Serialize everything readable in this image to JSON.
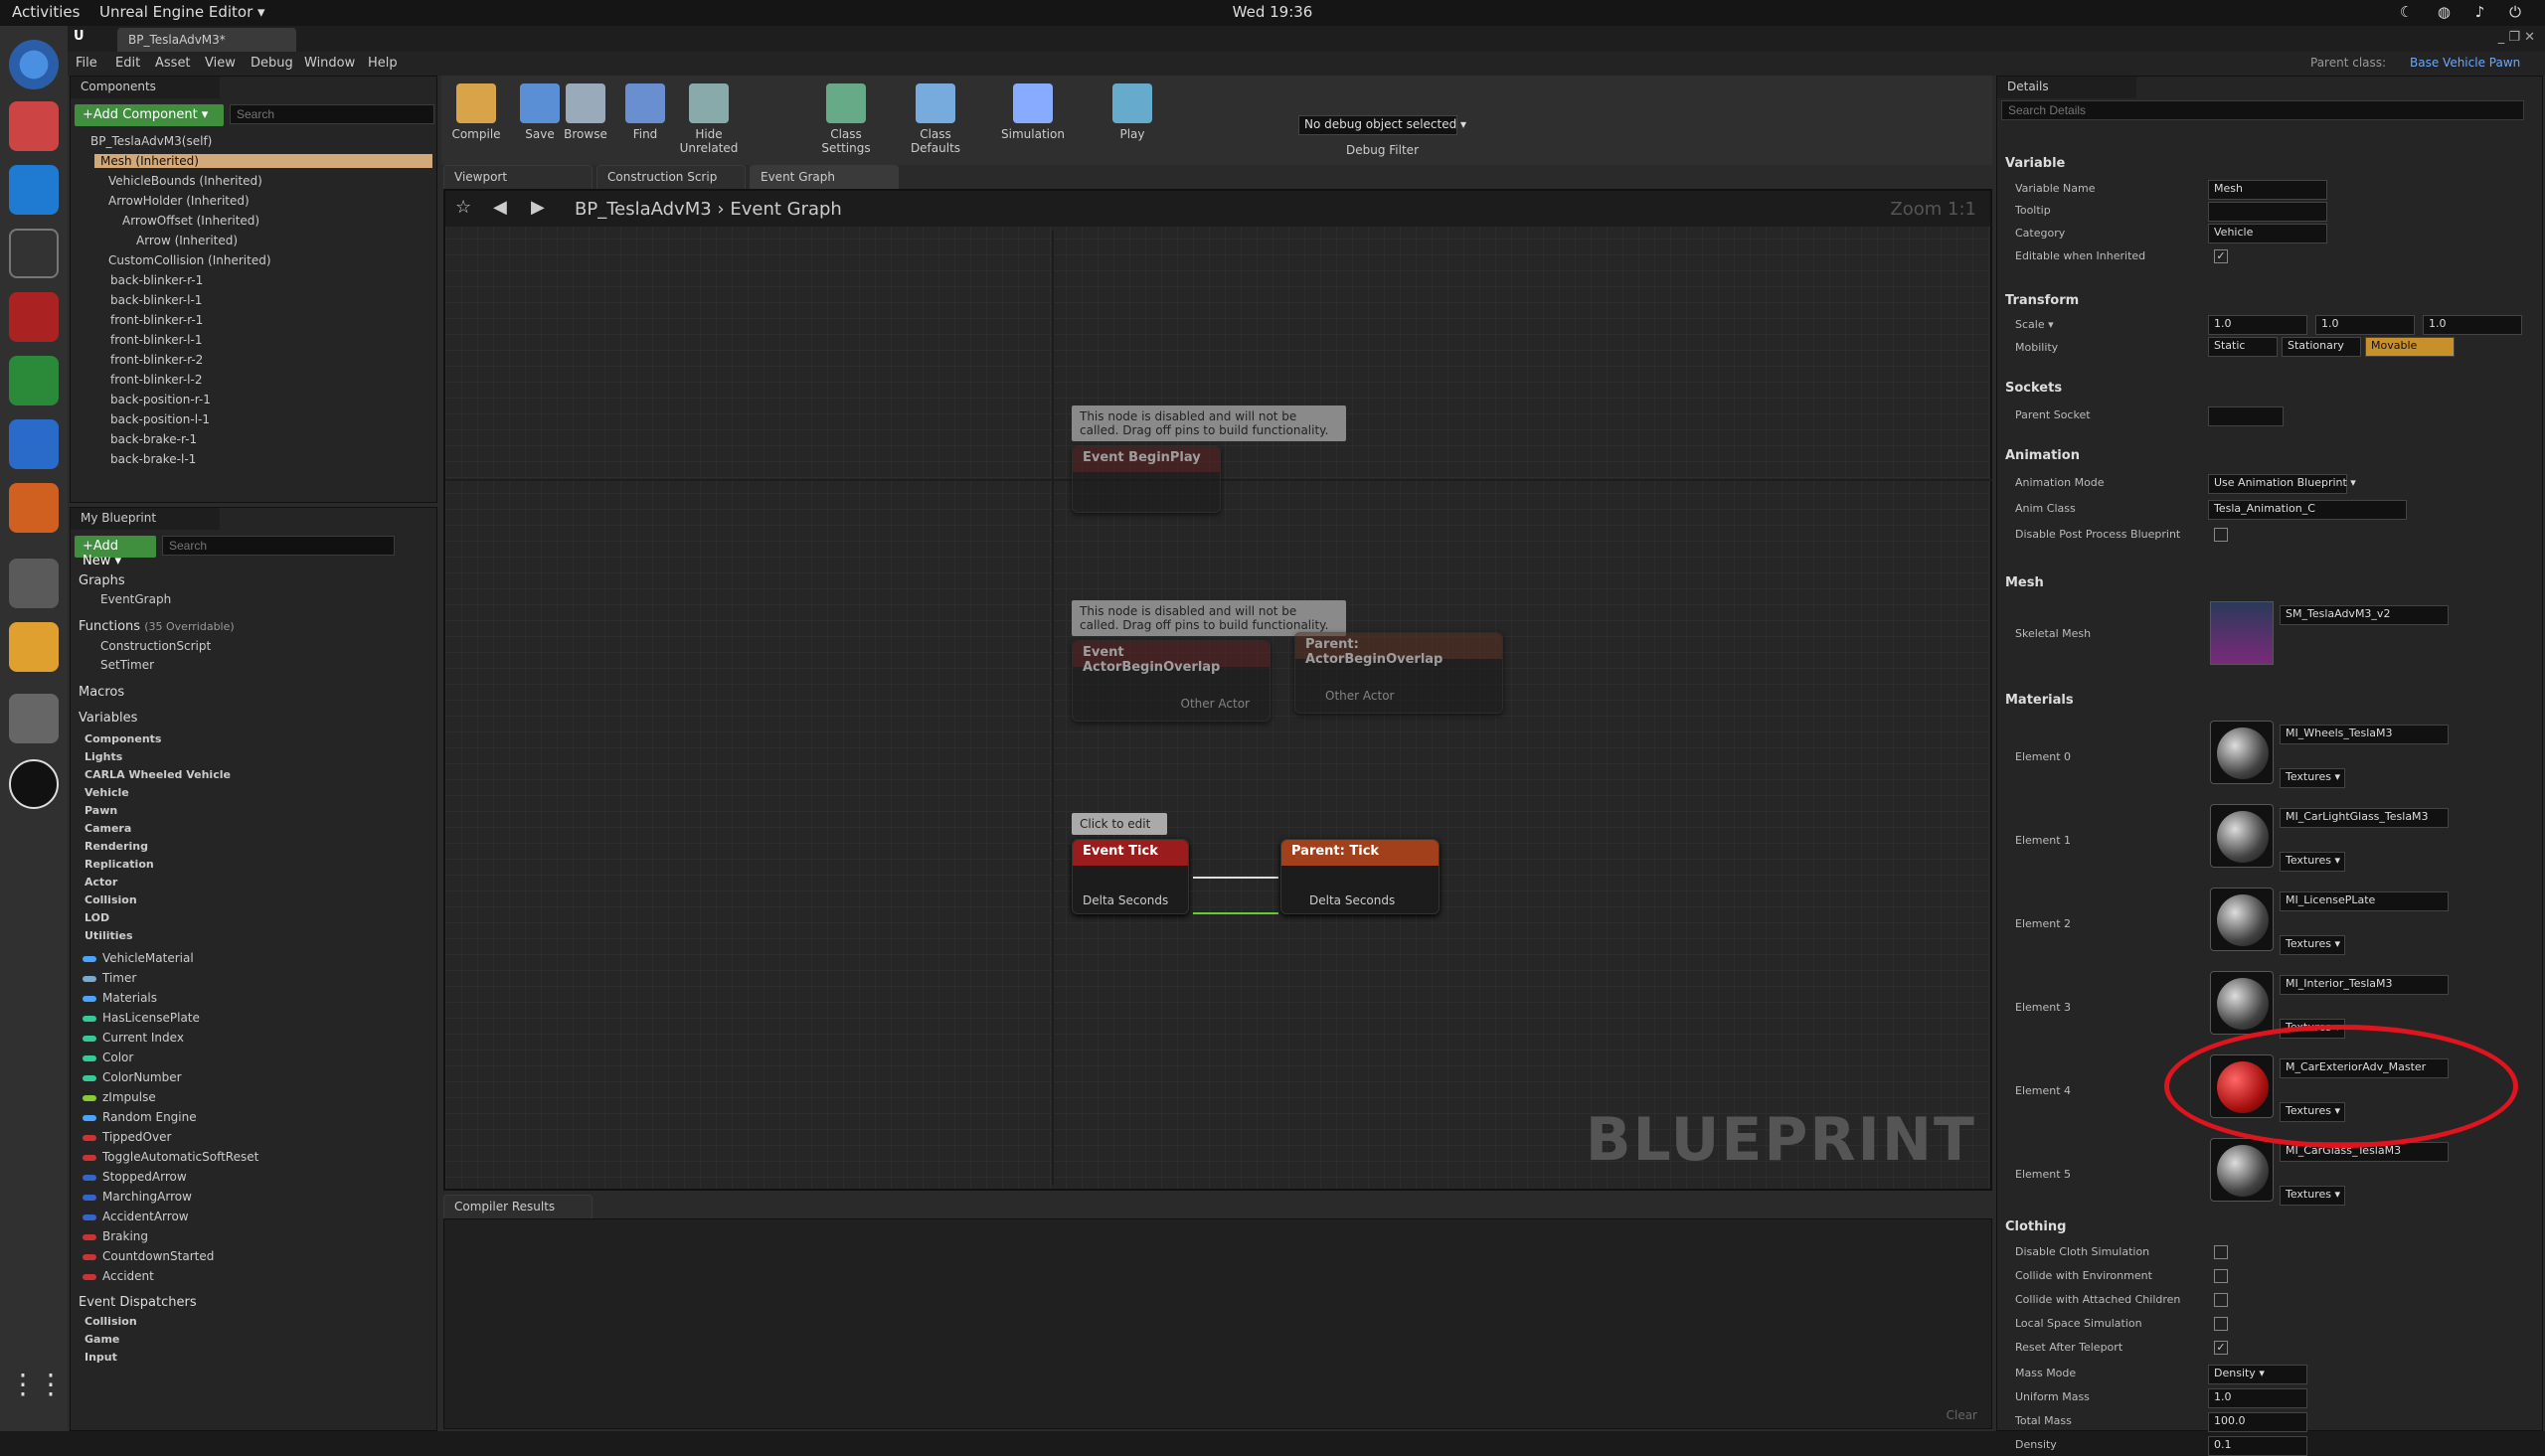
{
  "system": {
    "activities": "Activities",
    "app_menu": "Unreal Engine Editor ▾",
    "clock": "Wed 19:36"
  },
  "window": {
    "doc_tab": "BP_TeslaAdvM3*",
    "parent_class_label": "Parent class:",
    "parent_class": "Base Vehicle Pawn"
  },
  "menu": [
    "File",
    "Edit",
    "Asset",
    "View",
    "Debug",
    "Window",
    "Help"
  ],
  "components": {
    "tab": "Components",
    "add_label": "+Add Component ▾",
    "search_placeholder": "Search",
    "self": "BP_TeslaAdvM3(self)",
    "items": [
      "Mesh (Inherited)",
      "VehicleBounds (Inherited)",
      "ArrowHolder (Inherited)",
      "ArrowOffset (Inherited)",
      "Arrow (Inherited)",
      "CustomCollision (Inherited)",
      "back-blinker-r-1",
      "back-blinker-l-1",
      "front-blinker-r-1",
      "front-blinker-l-1",
      "front-blinker-r-2",
      "front-blinker-l-2",
      "back-position-r-1",
      "back-position-l-1",
      "back-brake-r-1",
      "back-brake-l-1"
    ]
  },
  "blueprint": {
    "tab": "My Blueprint",
    "add_label": "+Add New ▾",
    "search_placeholder": "Search",
    "graphs_label": "Graphs",
    "event_graph": "EventGraph",
    "functions_label": "Functions",
    "functions_count": "(35 Overridable)",
    "functions": [
      "ConstructionScript",
      "SetTimer"
    ],
    "macros_label": "Macros",
    "variables_label": "Variables",
    "var_categories": [
      "Components",
      "Lights",
      "CARLA Wheeled Vehicle",
      "Vehicle",
      "Pawn",
      "Camera",
      "Rendering",
      "Replication",
      "Actor",
      "Collision",
      "LOD",
      "Utilities"
    ],
    "variables": [
      "VehicleMaterial",
      "Timer",
      "Materials",
      "HasLicensePlate",
      "Current Index",
      "Color",
      "ColorNumber",
      "zImpulse",
      "Random Engine",
      "TippedOver",
      "ToggleAutomaticSoftReset",
      "StoppedArrow",
      "MarchingArrow",
      "AccidentArrow",
      "Braking",
      "CountdownStarted",
      "Accident"
    ],
    "dispatchers_label": "Event Dispatchers",
    "dispatchers": [
      "Collision",
      "Game",
      "Input"
    ]
  },
  "toolbar": [
    "Compile",
    "Save",
    "Browse",
    "Find",
    "Hide Unrelated",
    "Class Settings",
    "Class Defaults",
    "Simulation",
    "Play"
  ],
  "debug": {
    "selector": "No debug object selected ▾",
    "label": "Debug Filter"
  },
  "editor_tabs": [
    "Viewport",
    "Construction Scrip",
    "Event Graph"
  ],
  "graph": {
    "breadcrumb_root": "BP_TeslaAdvM3",
    "breadcrumb_leaf": "Event Graph",
    "zoom": "Zoom 1:1",
    "watermark": "BLUEPRINT",
    "disabled_note": "This node is disabled and will not be called. Drag off pins to build functionality.",
    "node_beginplay": "Event BeginPlay",
    "node_overlap": "Event ActorBeginOverlap",
    "node_parent_overlap": "Parent: ActorBeginOverlap",
    "other_actor": "Other Actor",
    "click_to_edit": "Click to edit",
    "node_tick": "Event Tick",
    "node_parent_tick": "Parent: Tick",
    "delta_seconds": "Delta Seconds"
  },
  "compiler": {
    "tab": "Compiler Results",
    "clear": "Clear"
  },
  "details": {
    "tab": "Details",
    "search_placeholder": "Search Details",
    "variable": {
      "head": "Variable",
      "name_label": "Variable Name",
      "name": "Mesh",
      "tooltip_label": "Tooltip",
      "category_label": "Category",
      "category": "Vehicle",
      "editable_label": "Editable when Inherited"
    },
    "transform": {
      "head": "Transform",
      "scale_label": "Scale ▾",
      "x": "1.0",
      "y": "1.0",
      "z": "1.0",
      "mobility_label": "Mobility",
      "static": "Static",
      "stationary": "Stationary",
      "movable": "Movable"
    },
    "sockets": {
      "head": "Sockets",
      "parent_label": "Parent Socket"
    },
    "animation": {
      "head": "Animation",
      "mode_label": "Animation Mode",
      "mode": "Use Animation Blueprint ▾",
      "class_label": "Anim Class",
      "class": "Tesla_Animation_C",
      "postprocess_label": "Disable Post Process Blueprint"
    },
    "mesh": {
      "head": "Mesh",
      "skel_label": "Skeletal Mesh",
      "skel": "SM_TeslaAdvM3_v2"
    },
    "materials": {
      "head": "Materials",
      "textures": "Textures ▾",
      "elements": [
        {
          "label": "Element 0",
          "name": "MI_Wheels_TeslaM3"
        },
        {
          "label": "Element 1",
          "name": "MI_CarLightGlass_TeslaM3"
        },
        {
          "label": "Element 2",
          "name": "MI_LicensePLate"
        },
        {
          "label": "Element 3",
          "name": "MI_Interior_TeslaM3"
        },
        {
          "label": "Element 4",
          "name": "M_CarExteriorAdv_Master"
        },
        {
          "label": "Element 5",
          "name": "MI_CarGlass_TeslaM3"
        }
      ]
    },
    "clothing": {
      "head": "Clothing",
      "disable_cloth": "Disable Cloth Simulation",
      "collide_env": "Collide with Environment",
      "collide_children": "Collide with Attached Children",
      "local_space": "Local Space Simulation",
      "reset_teleport": "Reset After Teleport",
      "mass_mode_label": "Mass Mode",
      "mass_mode": "Density ▾",
      "uniform_mass_label": "Uniform Mass",
      "uniform_mass": "1.0",
      "total_mass_label": "Total Mass",
      "total_mass": "100.0",
      "density_label": "Density",
      "density": "0.1"
    }
  },
  "colors": {
    "accent_green": "#3f8f3f",
    "selection": "#d4a97a",
    "highlight_ring": "#e0141e",
    "event_red": "#9b1c1c"
  }
}
